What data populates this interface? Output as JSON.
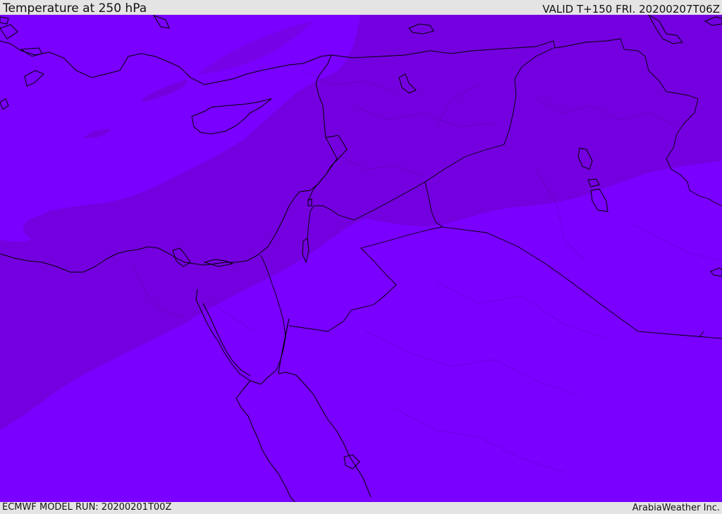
{
  "header": {
    "title": "Temperature at 250 hPa",
    "valid": "VALID T+150 FRI. 20200207T06Z"
  },
  "footer": {
    "model_run": "ECMWF MODEL RUN: 20200201T00Z",
    "credit": "ArabiaWeather Inc."
  },
  "colors": {
    "field_warm": "#7a00ff",
    "field_cold": "#7400df",
    "field_mid": "#7705ef",
    "coastline": "#000000",
    "border": "#000000",
    "bar_background": "#e4e4e4"
  }
}
